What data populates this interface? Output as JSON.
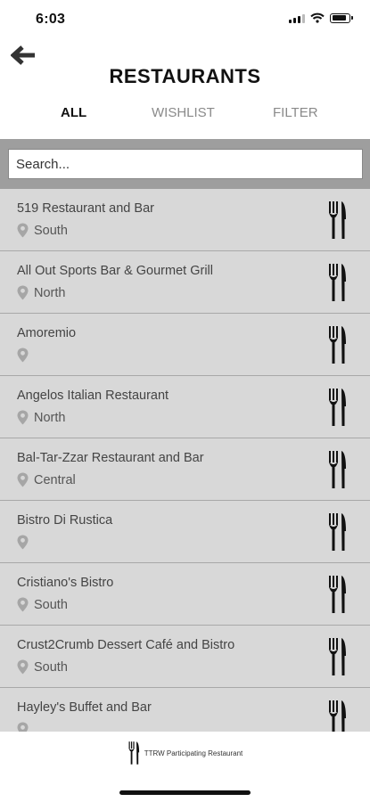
{
  "status": {
    "time": "6:03",
    "battery_level": 0.9
  },
  "header": {
    "title": "RESTAURANTS"
  },
  "tabs": [
    {
      "label": "ALL",
      "active": true
    },
    {
      "label": "WISHLIST",
      "active": false
    },
    {
      "label": "FILTER",
      "active": false
    }
  ],
  "search": {
    "placeholder": "Search..."
  },
  "restaurants": [
    {
      "name": "519 Restaurant and Bar",
      "region": "South"
    },
    {
      "name": "All Out Sports Bar & Gourmet Grill",
      "region": "North"
    },
    {
      "name": "Amoremio",
      "region": ""
    },
    {
      "name": "Angelos Italian Restaurant",
      "region": "North"
    },
    {
      "name": "Bal-Tar-Zzar Restaurant and Bar",
      "region": "Central"
    },
    {
      "name": "Bistro Di Rustica",
      "region": ""
    },
    {
      "name": "Cristiano's Bistro",
      "region": "South"
    },
    {
      "name": "Crust2Crumb Dessert Café and Bistro",
      "region": "South"
    },
    {
      "name": "Hayley's Buffet and Bar",
      "region": ""
    }
  ],
  "footer": {
    "legend_label": "TTRW Participating Restaurant"
  },
  "colors": {
    "list_background": "#9e9e9e",
    "row_background": "#d8d8d8",
    "pin": "#a6a6a6"
  },
  "icons": {
    "back": "arrow-left-icon",
    "location": "map-pin-icon",
    "utensils": "fork-knife-icon"
  }
}
